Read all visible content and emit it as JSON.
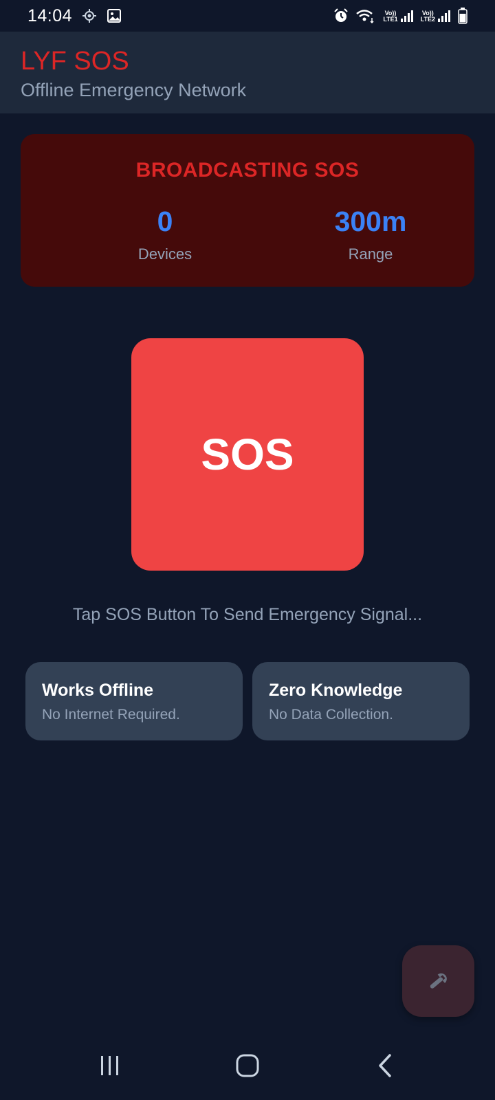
{
  "status_bar": {
    "time": "14:04",
    "icons": [
      "location-icon",
      "gallery-icon",
      "alarm-icon",
      "wifi-icon",
      "signal-icon",
      "signal-icon",
      "battery-icon"
    ],
    "sim1_label_top": "Vo))",
    "sim1_label_bottom": "LTE1",
    "sim2_label_top": "Vo))",
    "sim2_label_bottom": "LTE2"
  },
  "header": {
    "title": "LYF SOS",
    "subtitle": "Offline Emergency Network"
  },
  "broadcast": {
    "title": "BROADCASTING SOS",
    "devices_value": "0",
    "devices_label": "Devices",
    "range_value": "300m",
    "range_label": "Range"
  },
  "sos_button": {
    "label": "SOS"
  },
  "hint": "Tap SOS Button To Send Emergency Signal...",
  "features": [
    {
      "title": "Works Offline",
      "description": "No Internet Required."
    },
    {
      "title": "Zero Knowledge",
      "description": "No Data Collection."
    }
  ],
  "fab": {
    "icon": "wrench-icon"
  },
  "nav": {
    "icons": [
      "recents-icon",
      "home-icon",
      "back-icon"
    ]
  },
  "colors": {
    "background": "#0f172a",
    "header_bg": "#1e293b",
    "accent_red": "#dc2626",
    "sos_red": "#ef4444",
    "card_red": "#450a0a",
    "stat_blue": "#3b82f6",
    "feature_card": "#334155",
    "muted_text": "#94a3b8"
  }
}
